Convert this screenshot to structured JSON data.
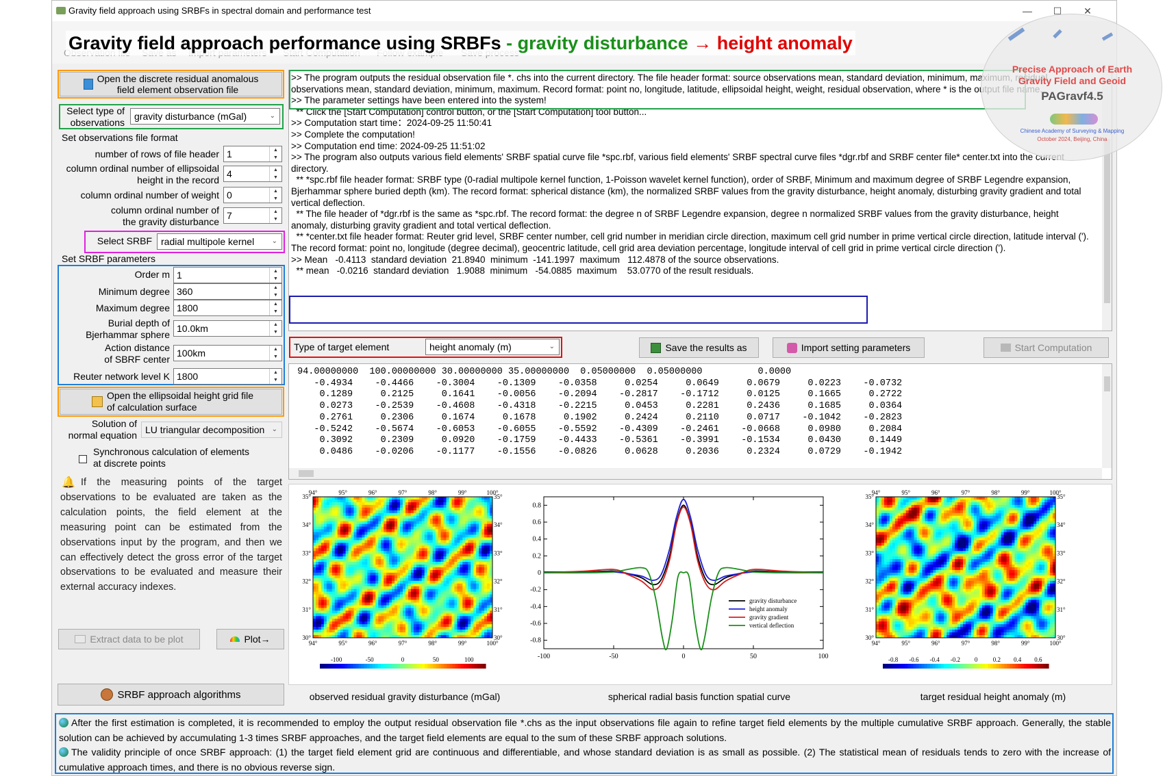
{
  "window": {
    "title": "Gravity field approach using SRBFs in spectral domain and performance test",
    "controls": {
      "minimize": "—",
      "maximize": "☐",
      "close": "✕"
    }
  },
  "toolbar": {
    "items": [
      "Observation file",
      "Save as",
      "Import parameters",
      "Start Computation",
      "Follow example",
      "Save process"
    ]
  },
  "banner": {
    "black": "Gravity field approach performance using SRBFs",
    "dash": " - ",
    "green": "gravity disturbance",
    "arrow": " → ",
    "red": "height anomaly"
  },
  "stamp": {
    "line1": "Precise Approach of Earth",
    "line2": "Gravity Field and Geoid",
    "line3": "PAGravf4.5",
    "line4": "Chinese Academy of Surveying & Mapping",
    "line5": "October 2024, Beijing, China"
  },
  "left": {
    "open_obs_button": "Open the discrete residual anomalous\nfield element observation file",
    "obs_type_label": "Select type of\nobservations",
    "obs_type_value": "gravity disturbance (mGal)",
    "format_header": "Set observations file format",
    "rows_header_label": "number of rows of file header",
    "rows_header_value": "1",
    "ellip_col_label": "column ordinal number of ellipsoidal\nheight in the record",
    "ellip_col_value": "4",
    "weight_col_label": "column ordinal number of weight",
    "weight_col_value": "0",
    "gd_col_label": "column ordinal number of\nthe gravity disturbance",
    "gd_col_value": "7",
    "srbf_label": "Select SRBF",
    "srbf_value": "radial multipole kernel",
    "srbf_params_header": "Set SRBF parameters",
    "order_label": "Order m",
    "order_value": "1",
    "min_deg_label": "Minimum degree",
    "min_deg_value": "360",
    "max_deg_label": "Maximum degree",
    "max_deg_value": "1800",
    "burial_label": "Burial depth of\nBjerhammar sphere",
    "burial_value": "10.0km",
    "action_label": "Action distance\nof SBRF center",
    "action_value": "100km",
    "reuter_label": "Reuter network level K",
    "reuter_value": "1800",
    "open_grid_button": "Open the ellipsoidal height grid file\nof calculation surface",
    "solution_label": "Solution of\nnormal equation",
    "solution_value": "LU triangular decomposition",
    "sync_label": "Synchronous calculation of elements\nat discrete points",
    "sync_checked": false,
    "note": "If the measuring points of the target observations to be evaluated are taken as the calculation points, the field element at the measuring point can be estimated from the observations input by the program, and then we can effectively detect the gross error of the target observations to be evaluated and measure their external accuracy indexes.",
    "extract_button": "Extract data to be plot",
    "plot_button": "Plot→",
    "algorithms_button": "SRBF approach algorithms"
  },
  "log": {
    "l1": ">> The program outputs the residual observation file *. chs into the current directory. The file header format: source observations mean, standard deviation, minimum, maximum, residual observations mean, standard deviation, minimum, maximum. Record format: point no, longitude, latitude, ellipsoidal height, weight, residual observation, where * is the output file name.",
    "l2": ">> The parameter settings have been entered into the system!",
    "l3": "  ** Click the [Start Computation] control button, or the [Start Computation] tool button...",
    "l4": ">> Computation start time：2024-09-25 11:50:41",
    "l5": ">> Complete the computation!",
    "l6": ">> Computation end time: 2024-09-25 11:51:02",
    "l7": ">> The program also outputs various field elements' SRBF spatial curve file *spc.rbf, various field elements' SRBF spectral curve files *dgr.rbf and SRBF center file* center.txt into the current directory.",
    "l8": "  ** *spc.rbf file header format: SRBF type (0-radial multipole kernel function, 1-Poisson wavelet kernel function), order of SRBF, Minimum and maximum degree of SRBF Legendre expansion, Bjerhammar sphere buried depth (km). The record format: spherical distance (km), the normalized SRBF values from the gravity disturbance, height anomaly, disturbing gravity gradient and total vertical deflection.",
    "l9": "  ** The file header of *dgr.rbf is the same as *spc.rbf. The record format: the degree n of SRBF Legendre expansion, degree n normalized SRBF values from the gravity disturbance, height anomaly, disturbing gravity gradient and total vertical deflection.",
    "l10": "  ** *center.txt file header format: Reuter grid level, SRBF center number, cell grid number in meridian circle direction, maximum cell grid number in prime vertical circle direction, latitude interval ('). The record format: point no, longitude (degree decimal), geocentric latitude, cell grid area deviation percentage, longitude interval of cell grid in prime vertical circle direction (').",
    "l11": ">> Mean   -0.4113  standard deviation  21.8940  minimum  -141.1997  maximum   112.4878 of the source observations.",
    "l12": "  ** mean   -0.0216  standard deviation   1.9088  minimum   -54.0885  maximum    53.0770 of the result residuals."
  },
  "target": {
    "label": "Type of target element",
    "value": "height anomaly (m)",
    "save_button": "Save the results as",
    "import_button": "Import setting parameters",
    "start_button": "Start Computation"
  },
  "grid": {
    "header": [
      "94.00000000",
      "100.00000000",
      "30.00000000",
      "35.00000000",
      "0.05000000",
      "0.05000000",
      "0.0000"
    ],
    "rows": [
      [
        "-0.4934",
        "-0.4466",
        "-0.3004",
        "-0.1309",
        "-0.0358",
        "0.0254",
        "0.0649",
        "0.0679",
        "0.0223",
        "-0.0732"
      ],
      [
        "0.1289",
        "0.2125",
        "0.1641",
        "-0.0056",
        "-0.2094",
        "-0.2817",
        "-0.1712",
        "0.0125",
        "0.1665",
        "0.2722"
      ],
      [
        "0.0273",
        "-0.2539",
        "-0.4608",
        "-0.4318",
        "-0.2215",
        "0.0453",
        "0.2281",
        "0.2436",
        "0.1685",
        "0.0364"
      ],
      [
        "0.2761",
        "0.2306",
        "0.1674",
        "0.1678",
        "0.1902",
        "0.2424",
        "0.2110",
        "0.0717",
        "-0.1042",
        "-0.2823"
      ],
      [
        "-0.5242",
        "-0.5674",
        "-0.6053",
        "-0.6055",
        "-0.5592",
        "-0.4309",
        "-0.2461",
        "-0.0668",
        "0.0980",
        "0.2084"
      ],
      [
        "0.3092",
        "0.2309",
        "0.0920",
        "-0.1759",
        "-0.4433",
        "-0.5361",
        "-0.3991",
        "-0.1534",
        "0.0430",
        "0.1449"
      ],
      [
        "0.0486",
        "-0.0206",
        "-0.1177",
        "-0.1556",
        "-0.0826",
        "0.0628",
        "0.2036",
        "0.2324",
        "0.0729",
        "-0.1942"
      ]
    ]
  },
  "map_axes": {
    "lon_ticks": [
      "94°",
      "95°",
      "96°",
      "97°",
      "98°",
      "99°",
      "100°"
    ],
    "lat_ticks": [
      "35°",
      "34°",
      "33°",
      "32°",
      "31°",
      "30°"
    ]
  },
  "colorbar_left": {
    "ticks": [
      "-100",
      "-50",
      "0",
      "50",
      "100"
    ]
  },
  "colorbar_right": {
    "ticks": [
      "-0.8",
      "-0.6",
      "-0.4",
      "-0.2",
      "0",
      "0.2",
      "0.4",
      "0.6"
    ]
  },
  "chart_data": {
    "type": "line",
    "xlim": [
      -100,
      100
    ],
    "ylim": [
      -0.9,
      0.9
    ],
    "x_ticks": [
      "-100",
      "-50",
      "0",
      "50",
      "100"
    ],
    "y_ticks": [
      "0.8",
      "0.6",
      "0.4",
      "0.2",
      "0",
      "-0.2",
      "-0.4",
      "-0.6",
      "-0.8"
    ],
    "series": [
      {
        "name": "gravity disturbance",
        "color": "#000000",
        "points": [
          [
            -100,
            0.0
          ],
          [
            -70,
            0.01
          ],
          [
            -50,
            0.02
          ],
          [
            -40,
            -0.01
          ],
          [
            -30,
            -0.06
          ],
          [
            -22,
            -0.14
          ],
          [
            -16,
            -0.08
          ],
          [
            -10,
            0.2
          ],
          [
            -5,
            0.6
          ],
          [
            0,
            0.8
          ],
          [
            5,
            0.6
          ],
          [
            10,
            0.2
          ],
          [
            16,
            -0.08
          ],
          [
            22,
            -0.14
          ],
          [
            30,
            -0.06
          ],
          [
            40,
            -0.01
          ],
          [
            50,
            0.02
          ],
          [
            70,
            0.01
          ],
          [
            100,
            0.0
          ]
        ]
      },
      {
        "name": "height anomaly",
        "color": "#1f1fd8",
        "points": [
          [
            -100,
            0.01
          ],
          [
            -70,
            0.01
          ],
          [
            -50,
            0.01
          ],
          [
            -40,
            -0.01
          ],
          [
            -30,
            -0.04
          ],
          [
            -22,
            -0.09
          ],
          [
            -16,
            -0.02
          ],
          [
            -10,
            0.28
          ],
          [
            -5,
            0.66
          ],
          [
            0,
            0.87
          ],
          [
            5,
            0.66
          ],
          [
            10,
            0.28
          ],
          [
            16,
            -0.02
          ],
          [
            22,
            -0.09
          ],
          [
            30,
            -0.04
          ],
          [
            40,
            -0.01
          ],
          [
            50,
            0.01
          ],
          [
            70,
            0.01
          ],
          [
            100,
            0.01
          ]
        ]
      },
      {
        "name": "gravity gradient",
        "color": "#d81f1f",
        "points": [
          [
            -100,
            0.0
          ],
          [
            -70,
            0.02
          ],
          [
            -50,
            0.04
          ],
          [
            -40,
            -0.02
          ],
          [
            -30,
            -0.1
          ],
          [
            -22,
            -0.2
          ],
          [
            -16,
            -0.13
          ],
          [
            -10,
            0.15
          ],
          [
            -5,
            0.58
          ],
          [
            0,
            0.78
          ],
          [
            5,
            0.58
          ],
          [
            10,
            0.15
          ],
          [
            16,
            -0.13
          ],
          [
            22,
            -0.2
          ],
          [
            30,
            -0.1
          ],
          [
            40,
            -0.02
          ],
          [
            50,
            0.04
          ],
          [
            70,
            0.02
          ],
          [
            100,
            0.0
          ]
        ]
      },
      {
        "name": "vertical deflection",
        "color": "#1a8f1a",
        "points": [
          [
            -100,
            0.0
          ],
          [
            -70,
            0.0
          ],
          [
            -50,
            0.01
          ],
          [
            -40,
            0.04
          ],
          [
            -30,
            0.06
          ],
          [
            -25,
            0.0
          ],
          [
            -20,
            -0.3
          ],
          [
            -15,
            -0.78
          ],
          [
            -12,
            -0.9
          ],
          [
            -8,
            -0.55
          ],
          [
            -4,
            -0.05
          ],
          [
            0,
            0.0
          ],
          [
            4,
            -0.05
          ],
          [
            8,
            -0.55
          ],
          [
            12,
            -0.9
          ],
          [
            15,
            -0.78
          ],
          [
            20,
            -0.3
          ],
          [
            25,
            0.0
          ],
          [
            30,
            0.06
          ],
          [
            40,
            0.04
          ],
          [
            50,
            0.01
          ],
          [
            70,
            0.0
          ],
          [
            100,
            0.0
          ]
        ]
      }
    ],
    "grid": false,
    "legend_position": "bottom-right"
  },
  "captions": {
    "left": "observed residual gravity disturbance (mGal)",
    "center": "spherical radial basis function spatial curve",
    "right": "target residual height anomaly (m)"
  },
  "footer": {
    "p1": "After the first estimation is completed, it is recommended to employ the output residual observation file *.chs as the input observations file again to refine target field elements by the multiple cumulative SRBF approach. Generally, the stable solution can be achieved by accumulating 1-3 times SRBF approaches, and the target field elements are equal to the sum of these SRBF approach solutions.",
    "p2": "The validity principle of once SRBF approach: (1) the target field element grid are continuous and differentiable, and whose standard deviation is as small as possible. (2) The statistical mean of residuals tends to zero with the increase of cumulative approach times, and there is no obvious reverse sign."
  },
  "colors": {
    "banner_green": "#1a8f1a",
    "banner_red": "#e00000",
    "box_orange": "#ff9900",
    "box_green": "#22a34a",
    "box_magenta": "#e020e0",
    "box_blue": "#1e7fd8",
    "box_navy": "#1a1ab0",
    "box_red": "#e01010"
  }
}
